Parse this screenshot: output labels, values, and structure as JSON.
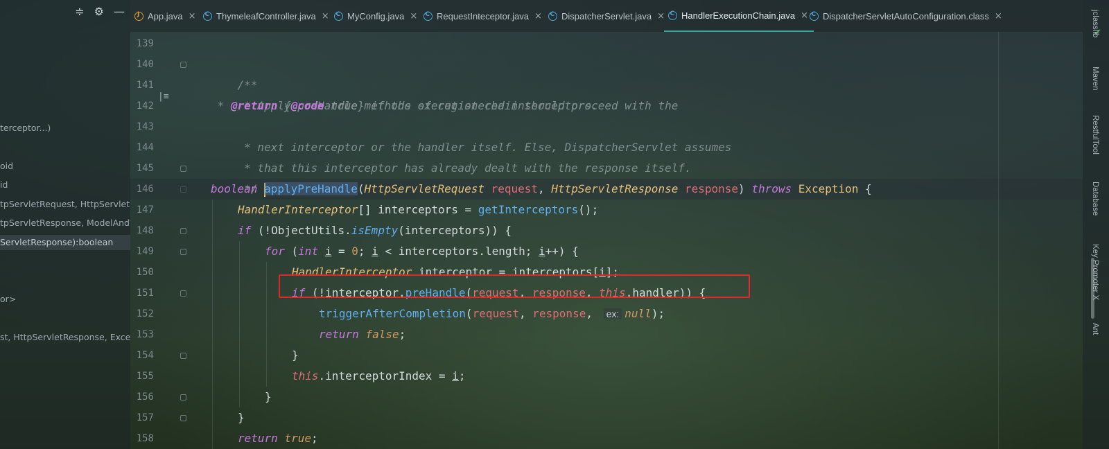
{
  "left_panel": {
    "toolbar": {
      "collapse_icon": "collapse-all-icon",
      "settings_icon": "gear-icon",
      "minimize_icon": "minimize-icon"
    },
    "items": [
      {
        "label": "terceptor...)"
      },
      {
        "label": "oid"
      },
      {
        "label": "id"
      },
      {
        "label": "tpServletRequest, HttpServletResponse"
      },
      {
        "label": "tpServletResponse, ModelAndView"
      },
      {
        "label": "ServletResponse):boolean"
      },
      {
        "label": "or>"
      },
      {
        "label": "st, HttpServletResponse, Exception)"
      }
    ]
  },
  "tabs": [
    {
      "label": "App.java",
      "close": "×"
    },
    {
      "label": "ThymeleafController.java",
      "close": "×"
    },
    {
      "label": "MyConfig.java",
      "close": "×"
    },
    {
      "label": "RequestInteceptor.java",
      "close": "×"
    },
    {
      "label": "DispatcherServlet.java",
      "close": "×"
    },
    {
      "label": "HandlerExecutionChain.java",
      "close": "×"
    },
    {
      "label": "DispatcherServletAutoConfiguration.class",
      "close": "×"
    }
  ],
  "editor": {
    "line_numbers": [
      "139",
      "140",
      "141",
      "142",
      "143",
      "144",
      "145",
      "146",
      "147",
      "148",
      "149",
      "150",
      "151",
      "152",
      "153",
      "154",
      "155",
      "156",
      "157",
      "158"
    ],
    "doc": {
      "open": "/**",
      "line1": " * Apply preHandle methods of registered interceptors.",
      "star": " * ",
      "return_tag": "@return",
      "brace_open": " {",
      "code_tag": "@code",
      "code_val": " true",
      "brace_close": "}",
      "line2_rest": " if the execution chain should proceed with the",
      "line3": " * next interceptor or the handler itself. Else, DispatcherServlet assumes",
      "line4": " * that this interceptor has already dealt with the response itself.",
      "close": " */"
    },
    "code": {
      "boolean": "boolean",
      "method": "applyPreHandle",
      "req_type": "HttpServletRequest",
      "req": "request",
      "resp_type": "HttpServletResponse",
      "resp": "response",
      "throws": "throws",
      "exception": "Exception",
      "handler_interceptor": "HandlerInterceptor",
      "interceptors": "interceptors",
      "get_interceptors": "getInterceptors",
      "if": "if",
      "object_utils": "ObjectUtils",
      "is_empty": "isEmpty",
      "for": "for",
      "int": "int",
      "i": "i",
      "zero": "0",
      "length": "length",
      "interceptor": "interceptor",
      "pre_handle": "preHandle",
      "this": "this",
      "handler": "handler",
      "trigger": "triggerAfterCompletion",
      "hint_ex": "ex:",
      "null": "null",
      "return": "return",
      "false": "false",
      "interceptor_index": "interceptorIndex",
      "true": "true"
    }
  },
  "right_tools": [
    {
      "label": "jclasslib"
    },
    {
      "label": "Maven"
    },
    {
      "label": "RestfulTool"
    },
    {
      "label": "Database"
    },
    {
      "label": "Key Promoter X"
    },
    {
      "label": "Ant"
    }
  ],
  "colors": {
    "accent": "#36a7a0",
    "highlight_box": "#e02828"
  }
}
